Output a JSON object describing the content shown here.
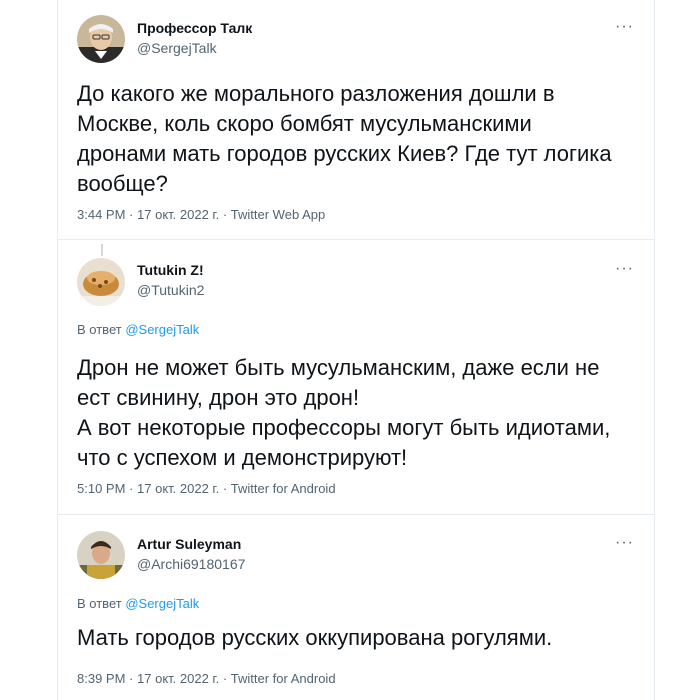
{
  "tweets": [
    {
      "name": "Профессор Талк",
      "handle": "@SergejTalk",
      "text": "До какого же морального разложения дошли в\nМоскве, коль скоро бомбят мусульманскими\nдронами  мать городов русских Киев? Где тут логика\nвообще?",
      "time": "3:44 PM",
      "date": "17 окт. 2022 г.",
      "source": "Twitter Web App",
      "more": "···"
    },
    {
      "name": "Tutukin Z!",
      "handle": "@Tutukin2",
      "reply_prefix": "В ответ",
      "reply_to": "@SergejTalk",
      "text": "Дрон не может быть мусульманским, даже если не\nест свинину, дрон это дрон!\nА вот некоторые профессоры могут быть идиотами,\nчто с успехом и демонстрируют!",
      "time": "5:10 PM",
      "date": "17 окт. 2022 г.",
      "source": "Twitter for Android",
      "more": "···"
    },
    {
      "name": "Artur Suleyman",
      "handle": "@Archi69180167",
      "reply_prefix": "В ответ",
      "reply_to": "@SergejTalk",
      "text": "Мать городов русских оккупирована рогулями.",
      "time": "8:39 PM",
      "date": "17 окт. 2022 г.",
      "source": "Twitter for Android",
      "more": "···"
    }
  ],
  "separator": "·",
  "colors": {
    "text": "#0f1419",
    "secondary": "#536471",
    "link": "#1d9bf0",
    "border": "#e6ecf0"
  }
}
